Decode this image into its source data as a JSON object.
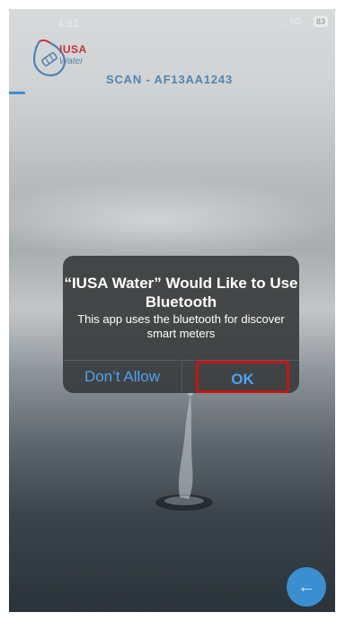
{
  "status_bar": {
    "time": "4:51",
    "signal": "...",
    "network": "5G",
    "battery": "83"
  },
  "brand": {
    "name": "IUSA",
    "sub": "Water",
    "logo_icon": "water-drop-icon"
  },
  "screen": {
    "title": "SCAN - AF13AA1243"
  },
  "dialog": {
    "title": "“IUSA Water” Would Like to Use Bluetooth",
    "message": "This app uses the bluetooth for discover smart meters",
    "deny_label": "Don’t Allow",
    "ok_label": "OK",
    "highlight_color": "#c01616"
  },
  "fab": {
    "icon": "arrow-left-icon",
    "glyph": "←",
    "color": "#3b8fd0"
  },
  "colors": {
    "accent": "#4e86b3",
    "brand_red": "#c6323a",
    "dialog_button": "#4aa3f1"
  }
}
